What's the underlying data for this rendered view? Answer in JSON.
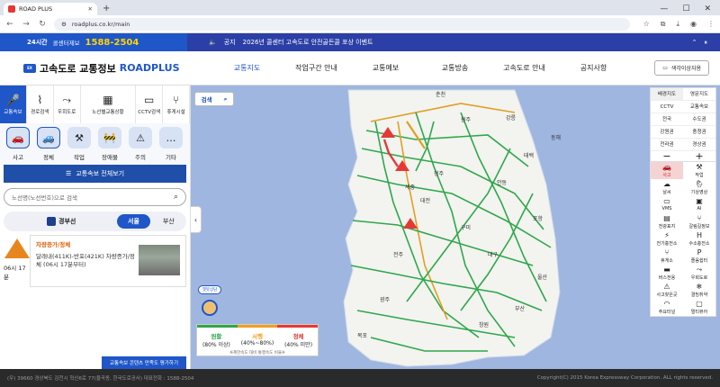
{
  "browser": {
    "tab_title": "ROAD PLUS",
    "url": "roadplus.co.kr/main"
  },
  "topstrip": {
    "badge": "24시간",
    "call_label": "콜센터제보",
    "call_number": "1588-2504",
    "notice_label": "공지",
    "notice_text": "2026년 콜센터 고속도로 안전골든콜 포상 이벤트"
  },
  "header": {
    "logo_ex": "EX",
    "logo_text": "고속도로 교통정보",
    "logo_brand": "ROADPLUS",
    "access_label": "색각이상자용",
    "nav": [
      {
        "label": "교통지도"
      },
      {
        "label": "작업구간 안내"
      },
      {
        "label": "교통예보"
      },
      {
        "label": "교통방송"
      },
      {
        "label": "고속도로 안내"
      },
      {
        "label": "공지사항"
      }
    ]
  },
  "left": {
    "categories": [
      {
        "label": "교통속보",
        "icon": "🎤"
      },
      {
        "label": "경로검색",
        "icon": "⌇"
      },
      {
        "label": "우회도로",
        "icon": "⤳"
      },
      {
        "label": "노선별교통상황",
        "icon": "▦"
      },
      {
        "label": "CCTV검색",
        "icon": "▭"
      },
      {
        "label": "휴게시설",
        "icon": "⑂"
      }
    ],
    "subtypes": [
      {
        "label": "사고",
        "icon": "🚗"
      },
      {
        "label": "정체",
        "icon": "🚙"
      },
      {
        "label": "작업",
        "icon": "⚒"
      },
      {
        "label": "장애물",
        "icon": "🚧"
      },
      {
        "label": "주의",
        "icon": "⚠"
      },
      {
        "label": "기타",
        "icon": "…"
      }
    ],
    "all_button": "교통속보 전체보기",
    "search_placeholder": "노선명(노선번호)으로 검색",
    "route_name": "경부선",
    "dir_active": "서울",
    "dir_other": "부산",
    "incident": {
      "time": "06시 17분",
      "title": "차량증가/정체",
      "desc": "달래내(411K)-반포(421K) 차량증가/정체 (06시 17분부터)"
    },
    "survey": "교통속보 콘텐츠 만족도 평가하기"
  },
  "map": {
    "search_label": "검색",
    "mascot_label": "챗봇상담",
    "labels": [
      {
        "t": "춘천"
      },
      {
        "t": "원주"
      },
      {
        "t": "강릉"
      },
      {
        "t": "태백"
      },
      {
        "t": "청주"
      },
      {
        "t": "대전"
      },
      {
        "t": "안동"
      },
      {
        "t": "포항"
      },
      {
        "t": "대구"
      },
      {
        "t": "전주"
      },
      {
        "t": "광주"
      },
      {
        "t": "부산"
      },
      {
        "t": "울산"
      },
      {
        "t": "동해"
      },
      {
        "t": "세종"
      },
      {
        "t": "창원"
      },
      {
        "t": "목포"
      },
      {
        "t": "구미"
      }
    ],
    "legend": [
      {
        "label": "원활",
        "range": "(80% 이상)",
        "color": "#2ea84a"
      },
      {
        "label": "서행",
        "range": "(40%~80%)",
        "color": "#f0a020"
      },
      {
        "label": "정체",
        "range": "(40% 미만)",
        "color": "#e53935"
      }
    ],
    "legend_note": "※제한속도 대비 통행속도 비율※"
  },
  "right_panel": {
    "views": [
      {
        "label": "배경지도"
      },
      {
        "label": "영문지도"
      },
      {
        "label": "CCTV"
      },
      {
        "label": "교통속보"
      },
      {
        "label": "전국"
      },
      {
        "label": "수도권"
      },
      {
        "label": "강원권"
      },
      {
        "label": "충청권"
      },
      {
        "label": "전라권"
      },
      {
        "label": "경상권"
      }
    ],
    "zoom_out": "−",
    "zoom_in": "+",
    "layers": [
      {
        "label": "사고",
        "icon": "🚗"
      },
      {
        "label": "작업",
        "icon": "⚒"
      },
      {
        "label": "날씨",
        "icon": "☁"
      },
      {
        "label": "기상영상",
        "icon": "🌦"
      },
      {
        "label": "VMS",
        "icon": "▭"
      },
      {
        "label": "AI",
        "icon": "▣"
      },
      {
        "label": "전광표지",
        "icon": "▤"
      },
      {
        "label": "갈림길정보",
        "icon": "⑂"
      },
      {
        "label": "전기충전소",
        "icon": "⚡"
      },
      {
        "label": "수소충전소",
        "icon": "H"
      },
      {
        "label": "휴게소",
        "icon": "⑂"
      },
      {
        "label": "졸음쉼터",
        "icon": "P"
      },
      {
        "label": "버스전용",
        "icon": "▬"
      },
      {
        "label": "우회도로",
        "icon": "⤳"
      },
      {
        "label": "사고잦은곳",
        "icon": "⚠"
      },
      {
        "label": "결빙취약",
        "icon": "❄"
      },
      {
        "label": "주요터널",
        "icon": "◠"
      },
      {
        "label": "멀티뷰어",
        "icon": "▢"
      }
    ]
  },
  "footer": {
    "address": "(우) 39660 경상북도 김천시 혁신6로 77(율곡동, 한국도로공사) 대표전화 : 1588-2504",
    "copyright": "Copyright(C) 2015 Korea Expressway Corporation. ALL rights reserved."
  }
}
